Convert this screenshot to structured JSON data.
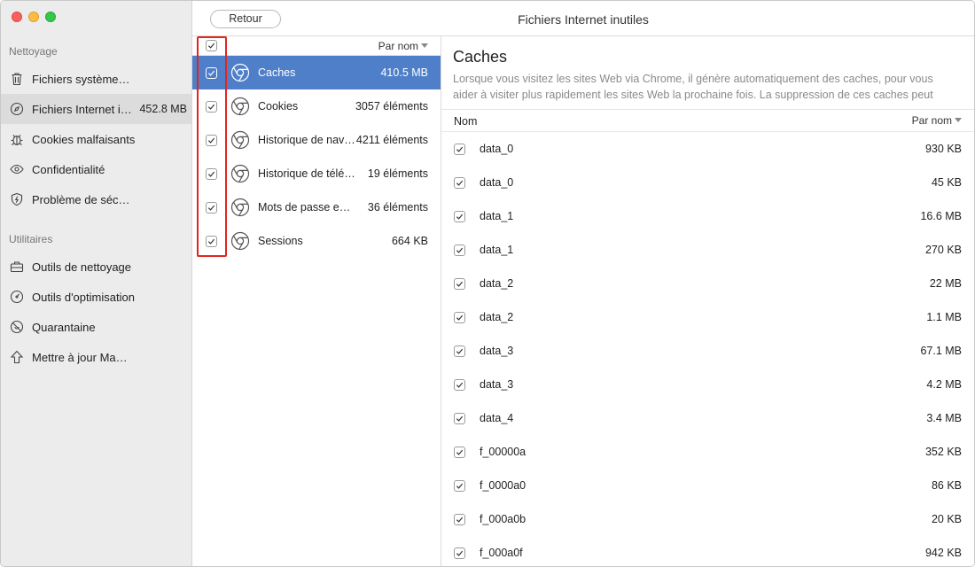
{
  "window": {
    "title": "Fichiers Internet inutiles",
    "back_label": "Retour"
  },
  "sidebar": {
    "section_cleaning": "Nettoyage",
    "section_utilities": "Utilitaires",
    "cleaning_items": [
      {
        "label": "Fichiers système…",
        "icon": "trash-icon",
        "size": ""
      },
      {
        "label": "Fichiers Internet i…",
        "icon": "compass-icon",
        "size": "452.8 MB"
      },
      {
        "label": "Cookies malfaisants",
        "icon": "bug-icon",
        "size": ""
      },
      {
        "label": "Confidentialité",
        "icon": "eye-icon",
        "size": ""
      },
      {
        "label": "Problème de séc…",
        "icon": "shield-icon",
        "size": ""
      }
    ],
    "utility_items": [
      {
        "label": "Outils de nettoyage",
        "icon": "toolbox-icon"
      },
      {
        "label": "Outils d'optimisation",
        "icon": "gauge-icon"
      },
      {
        "label": "Quarantaine",
        "icon": "quarantine-icon"
      },
      {
        "label": "Mettre à jour Ma…",
        "icon": "arrow-up-icon"
      }
    ]
  },
  "list": {
    "sort_label": "Par nom",
    "items": [
      {
        "name": "Caches",
        "count": "410.5 MB"
      },
      {
        "name": "Cookies",
        "count": "3057 éléments"
      },
      {
        "name": "Historique de navi…",
        "count": "4211 éléments"
      },
      {
        "name": "Historique de télé…",
        "count": "19 éléments"
      },
      {
        "name": "Mots de passe en…",
        "count": "36 éléments"
      },
      {
        "name": "Sessions",
        "count": "664 KB"
      }
    ]
  },
  "detail": {
    "title": "Caches",
    "description": "Lorsque vous visitez les sites Web via Chrome, il génère automatiquement des caches, pour vous aider à visiter plus rapidement les sites Web la prochaine fois. La suppression de ces caches peut vous aider à…",
    "col_name": "Nom",
    "sort_label": "Par nom",
    "files": [
      {
        "name": "data_0",
        "size": "930 KB"
      },
      {
        "name": "data_0",
        "size": "45 KB"
      },
      {
        "name": "data_1",
        "size": "16.6 MB"
      },
      {
        "name": "data_1",
        "size": "270 KB"
      },
      {
        "name": "data_2",
        "size": "22 MB"
      },
      {
        "name": "data_2",
        "size": "1.1 MB"
      },
      {
        "name": "data_3",
        "size": "67.1 MB"
      },
      {
        "name": "data_3",
        "size": "4.2 MB"
      },
      {
        "name": "data_4",
        "size": "3.4 MB"
      },
      {
        "name": "f_00000a",
        "size": "352 KB"
      },
      {
        "name": "f_0000a0",
        "size": "86 KB"
      },
      {
        "name": "f_000a0b",
        "size": "20 KB"
      },
      {
        "name": "f_000a0f",
        "size": "942 KB"
      }
    ]
  }
}
